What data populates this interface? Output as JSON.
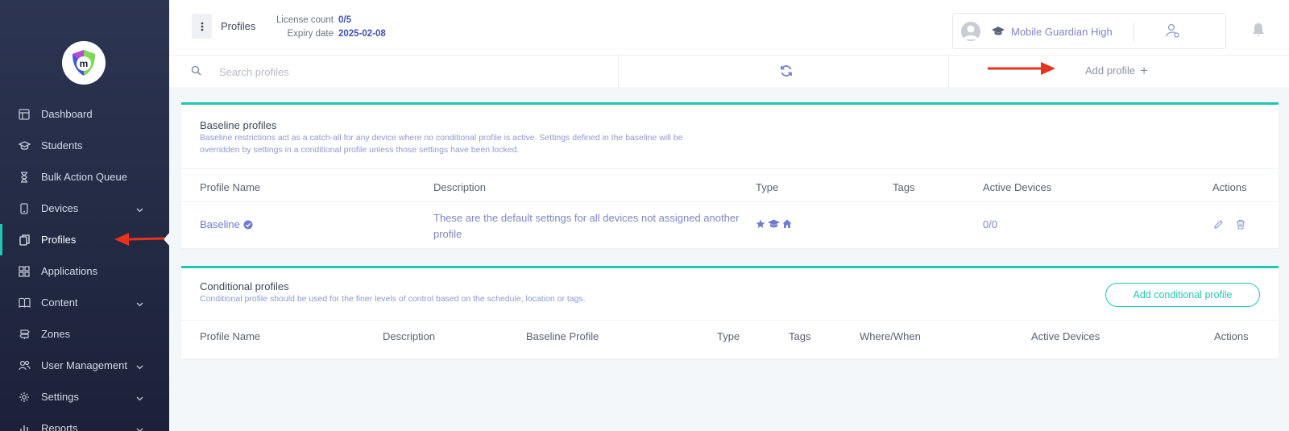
{
  "sidebar": {
    "items": [
      {
        "label": "Dashboard",
        "icon": "layout-icon",
        "has_chevron": false,
        "active": false
      },
      {
        "label": "Students",
        "icon": "graduation-cap-icon",
        "has_chevron": false,
        "active": false
      },
      {
        "label": "Bulk Action Queue",
        "icon": "hourglass-icon",
        "has_chevron": false,
        "active": false
      },
      {
        "label": "Devices",
        "icon": "phone-icon",
        "has_chevron": true,
        "active": false
      },
      {
        "label": "Profiles",
        "icon": "documents-icon",
        "has_chevron": false,
        "active": true
      },
      {
        "label": "Applications",
        "icon": "grid-icon",
        "has_chevron": false,
        "active": false
      },
      {
        "label": "Content",
        "icon": "book-icon",
        "has_chevron": true,
        "active": false
      },
      {
        "label": "Zones",
        "icon": "sign-icon",
        "has_chevron": false,
        "active": false
      },
      {
        "label": "User Management",
        "icon": "users-icon",
        "has_chevron": true,
        "active": false
      },
      {
        "label": "Settings",
        "icon": "gear-icon",
        "has_chevron": true,
        "active": false
      },
      {
        "label": "Reports",
        "icon": "chart-icon",
        "has_chevron": true,
        "active": false
      }
    ]
  },
  "header": {
    "title": "Profiles",
    "license_label": "License count",
    "license_value": "0/5",
    "expiry_label": "Expiry date",
    "expiry_value": "2025-02-08",
    "org_name": "Mobile Guardian High"
  },
  "toolbar": {
    "search_placeholder": "Search profiles",
    "add_profile_label": "Add profile"
  },
  "baseline": {
    "title": "Baseline profiles",
    "description_line1": "Baseline restrictions act as a catch-all for any device where no conditional profile is active. Settings defined in the baseline will be",
    "description_line2": "overridden by settings in a conditional profile unless those settings have been locked.",
    "columns": {
      "name": "Profile Name",
      "description": "Description",
      "type": "Type",
      "tags": "Tags",
      "active_devices": "Active Devices",
      "actions": "Actions"
    },
    "rows": [
      {
        "name": "Baseline",
        "description_line1": "These are the default settings for all devices not assigned another",
        "description_line2": "profile",
        "active_devices": "0/0"
      }
    ]
  },
  "conditional": {
    "title": "Conditional profiles",
    "description": "Conditional profile should be used for the finer levels of control based on the schedule, location or tags.",
    "add_button_label": "Add conditional profile",
    "columns": {
      "name": "Profile Name",
      "description": "Description",
      "baseline_profile": "Baseline Profile",
      "type": "Type",
      "tags": "Tags",
      "where_when": "Where/When",
      "active_devices": "Active Devices",
      "actions": "Actions"
    }
  },
  "colors": {
    "sidebar_bg": "#232a44",
    "accent_teal": "#22c6b5",
    "link_blue": "#6f7bd2",
    "annotation_red": "#e8321e"
  }
}
